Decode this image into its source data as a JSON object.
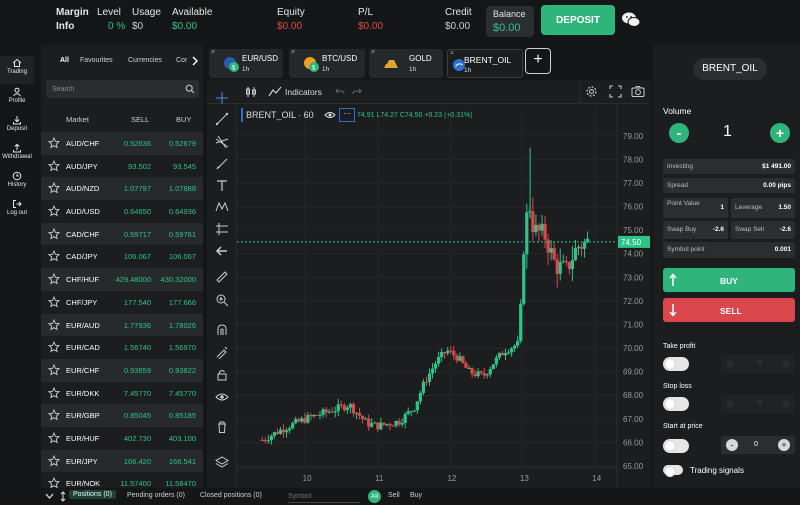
{
  "topbar": {
    "margin_label": "Margin",
    "info_label": "Info",
    "level_label": "Level",
    "level_value": "0 %",
    "usage_label": "Usage",
    "usage_value": "$0",
    "available_label": "Available",
    "available_value": "$0.00",
    "equity_label": "Equity",
    "equity_value": "$0.00",
    "pl_label": "P/L",
    "pl_value": "$0.00",
    "credit_label": "Credit",
    "credit_value": "$0.00",
    "balance_label": "Balance",
    "balance_value": "$0.00",
    "deposit_label": "DEPOSIT"
  },
  "nav": [
    {
      "label": "Trading",
      "icon": "home-icon"
    },
    {
      "label": "Profile",
      "icon": "user-icon"
    },
    {
      "label": "Deposit",
      "icon": "download-icon"
    },
    {
      "label": "Withdrawal",
      "icon": "upload-icon"
    },
    {
      "label": "History",
      "icon": "clock-icon"
    },
    {
      "label": "Log out",
      "icon": "logout-icon"
    }
  ],
  "market": {
    "categories": [
      "All",
      "Favourites",
      "Currencies",
      "Cor"
    ],
    "search_placeholder": "Search",
    "headers": {
      "market": "Market",
      "sell": "SELL",
      "buy": "BUY"
    },
    "rows": [
      {
        "name": "AUD/CHF",
        "sell": "0.52636",
        "buy": "0.52679"
      },
      {
        "name": "AUD/JPY",
        "sell": "93.502",
        "buy": "93.545"
      },
      {
        "name": "AUD/NZD",
        "sell": "1.07797",
        "buy": "1.07888"
      },
      {
        "name": "AUD/USD",
        "sell": "0.64850",
        "buy": "0.64936"
      },
      {
        "name": "CAD/CHF",
        "sell": "0.59717",
        "buy": "0.59761"
      },
      {
        "name": "CAD/JPY",
        "sell": "106.067",
        "buy": "106.067"
      },
      {
        "name": "CHF/HUF",
        "sell": "429.48000",
        "buy": "430.32000"
      },
      {
        "name": "CHF/JPY",
        "sell": "177.540",
        "buy": "177.666"
      },
      {
        "name": "EUR/AUD",
        "sell": "1.77936",
        "buy": "1.78026"
      },
      {
        "name": "EUR/CAD",
        "sell": "1.56740",
        "buy": "1.56970"
      },
      {
        "name": "EUR/CHF",
        "sell": "0.93659",
        "buy": "0.93822"
      },
      {
        "name": "EUR/DKK",
        "sell": "7.45770",
        "buy": "7.45770"
      },
      {
        "name": "EUR/GBP",
        "sell": "0.85045",
        "buy": "0.85185"
      },
      {
        "name": "EUR/HUF",
        "sell": "402.730",
        "buy": "403.100"
      },
      {
        "name": "EUR/JPY",
        "sell": "166.420",
        "buy": "166.541"
      },
      {
        "name": "EUR/NOK",
        "sell": "11.57400",
        "buy": "11.58470"
      }
    ]
  },
  "tabs": [
    {
      "name": "EUR/USD",
      "tf": "1h"
    },
    {
      "name": "BTC/USD",
      "tf": "1h"
    },
    {
      "name": "GOLD",
      "tf": "1h"
    },
    {
      "name": "BRENT_OIL",
      "tf": "1h"
    }
  ],
  "toolbar": {
    "indicators_label": "Indicators"
  },
  "legend": {
    "symbol": "BRENT_OIL · 60",
    "ohlc": "74.91  L74.27  C74.50  +0.23 (+0.31%)"
  },
  "chart_data": {
    "type": "candlestick",
    "symbol": "BRENT_OIL",
    "interval": "60",
    "ylim": [
      65,
      79.5
    ],
    "yticks": [
      65,
      66,
      67,
      68,
      69,
      70,
      71,
      72,
      73,
      74,
      75,
      76,
      77,
      78,
      79
    ],
    "ytick_labels": [
      "65.00",
      "66.00",
      "67.00",
      "68.00",
      "69.00",
      "70.00",
      "71.00",
      "72.00",
      "73.00",
      "74.00",
      "75.00",
      "76.00",
      "77.00",
      "78.00",
      "79.00"
    ],
    "xticks": [
      10,
      11,
      12,
      13,
      14
    ],
    "xtick_labels": [
      "10",
      "11",
      "12",
      "13",
      "14"
    ],
    "xlim": [
      9.3,
      14.3
    ],
    "last_price": 74.5,
    "last_price_label": "74.50",
    "up_color": "#2fc487",
    "down_color": "#e0474d"
  },
  "right_panel": {
    "instrument": "BRENT_OIL",
    "volume_label": "Volume",
    "volume_value": "1",
    "minus": "-",
    "plus": "+",
    "investing_label": "Investing",
    "investing_value": "$1 491.00",
    "spread_label": "Spread",
    "spread_value": "0.00 pips",
    "point_value_label": "Point Value",
    "point_value_value": "1",
    "leverage_label": "Leverage",
    "leverage_value": "1.50",
    "swap_buy_label": "Swap Buy",
    "swap_buy_value": "-2.6",
    "swap_sell_label": "Swap Sell",
    "swap_sell_value": "-2.6",
    "symbol_point_label": "Symbol point",
    "symbol_point_value": "0.001",
    "buy_label": "BUY",
    "sell_label": "SELL",
    "take_profit_label": "Take profit",
    "stop_loss_label": "Stop loss",
    "start_price_label": "Start at price",
    "start_price_value": "0",
    "trading_signals_label": "Trading signals"
  },
  "bottombar": {
    "positions": "Positions (0)",
    "pending": "Pending orders (0)",
    "closed": "Closed positions (0)",
    "symbol_placeholder": "Symbol",
    "filter_all": "All",
    "filter_sell": "Sell",
    "filter_buy": "Buy"
  }
}
